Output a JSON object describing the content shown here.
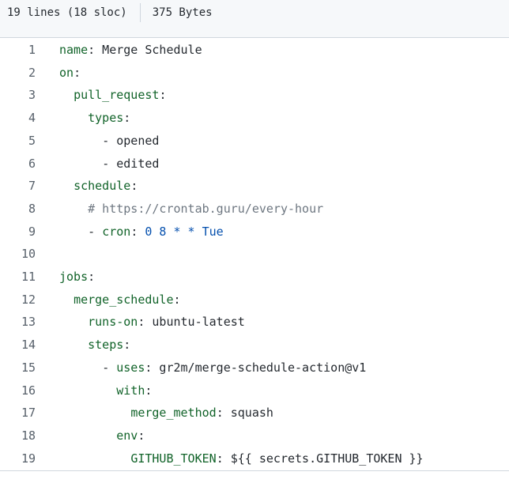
{
  "file_info": {
    "lines": "19 lines (18 sloc)",
    "size": "375 Bytes"
  },
  "code": [
    {
      "number": "1",
      "text": "name: Merge Schedule"
    },
    {
      "number": "2",
      "text": "on:"
    },
    {
      "number": "3",
      "text": "  pull_request:"
    },
    {
      "number": "4",
      "text": "    types:"
    },
    {
      "number": "5",
      "text": "      - opened"
    },
    {
      "number": "6",
      "text": "      - edited"
    },
    {
      "number": "7",
      "text": "  schedule:"
    },
    {
      "number": "8",
      "text": "    # https://crontab.guru/every-hour"
    },
    {
      "number": "9",
      "text": "    - cron: 0 8 * * Tue"
    },
    {
      "number": "10",
      "text": ""
    },
    {
      "number": "11",
      "text": "jobs:"
    },
    {
      "number": "12",
      "text": "  merge_schedule:"
    },
    {
      "number": "13",
      "text": "    runs-on: ubuntu-latest"
    },
    {
      "number": "14",
      "text": "    steps:"
    },
    {
      "number": "15",
      "text": "      - uses: gr2m/merge-schedule-action@v1"
    },
    {
      "number": "16",
      "text": "        with:"
    },
    {
      "number": "17",
      "text": "          merge_method: squash"
    },
    {
      "number": "18",
      "text": "        env:"
    },
    {
      "number": "19",
      "text": "          GITHUB_TOKEN: ${{ secrets.GITHUB_TOKEN }}"
    }
  ]
}
